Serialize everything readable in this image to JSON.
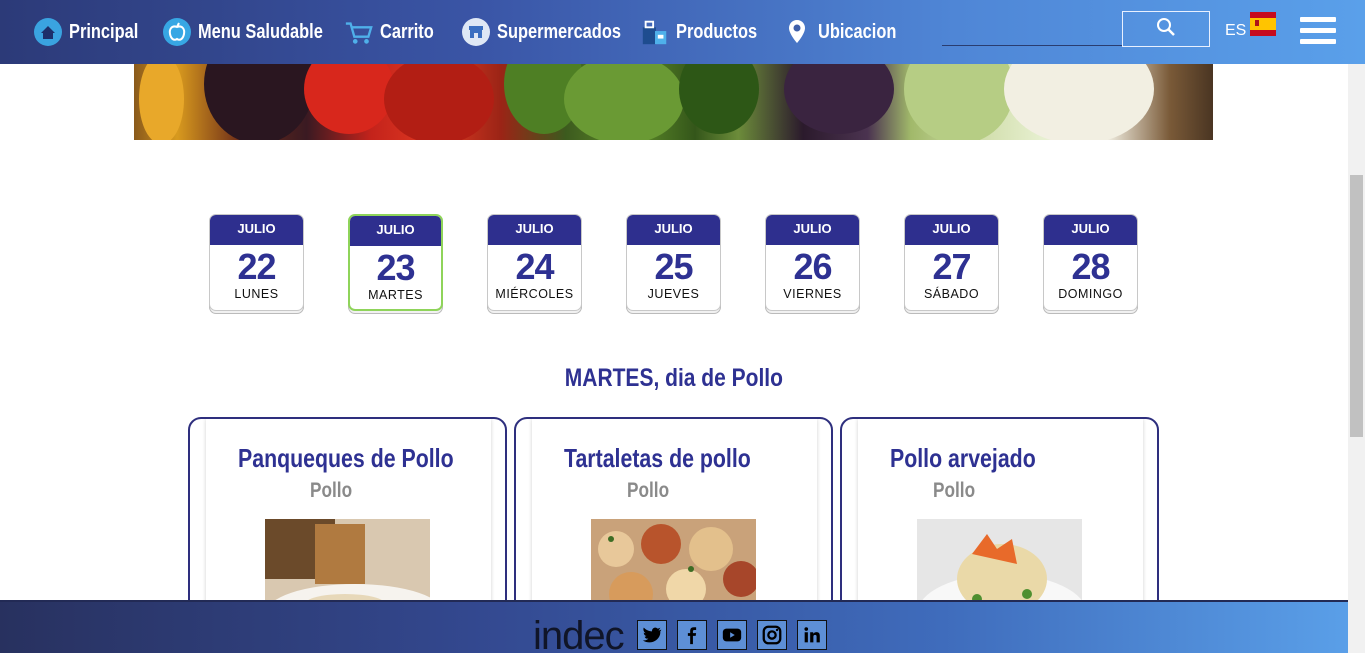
{
  "nav": {
    "items": [
      {
        "label": "Principal",
        "icon": "home-icon"
      },
      {
        "label": "Menu Saludable",
        "icon": "apple-icon"
      },
      {
        "label": "Carrito",
        "icon": "cart-icon"
      },
      {
        "label": "Supermercados",
        "icon": "store-icon"
      },
      {
        "label": "Productos",
        "icon": "products-icon"
      },
      {
        "label": "Ubicacion",
        "icon": "location-pin-icon"
      }
    ],
    "search_icon": "search-icon",
    "language": "ES",
    "flag_icon": "spain-flag-icon",
    "menu_icon": "hamburger-menu-icon"
  },
  "calendar": {
    "days": [
      {
        "month": "JULIO",
        "day_number": "22",
        "weekday": "LUNES"
      },
      {
        "month": "JULIO",
        "day_number": "23",
        "weekday": "MARTES",
        "selected": true
      },
      {
        "month": "JULIO",
        "day_number": "24",
        "weekday": "MIÉRCOLES"
      },
      {
        "month": "JULIO",
        "day_number": "25",
        "weekday": "JUEVES"
      },
      {
        "month": "JULIO",
        "day_number": "26",
        "weekday": "VIERNES"
      },
      {
        "month": "JULIO",
        "day_number": "27",
        "weekday": "SÁBADO"
      },
      {
        "month": "JULIO",
        "day_number": "28",
        "weekday": "DOMINGO"
      }
    ]
  },
  "menu_title": "MARTES, dia de Pollo",
  "recipes": [
    {
      "title": "Panqueques de Pollo",
      "category": "Pollo"
    },
    {
      "title": "Tartaletas de pollo",
      "category": "Pollo"
    },
    {
      "title": "Pollo arvejado",
      "category": "Pollo"
    }
  ],
  "footer": {
    "logo_text": "indec",
    "social": [
      "twitter-icon",
      "facebook-icon",
      "youtube-icon",
      "instagram-icon",
      "linkedin-icon"
    ]
  },
  "colors": {
    "brand_blue": "#2e3192",
    "calendar_header": "#2e2f8e",
    "selected_border": "#8fd45a",
    "category_gray": "#8a8a8a"
  }
}
